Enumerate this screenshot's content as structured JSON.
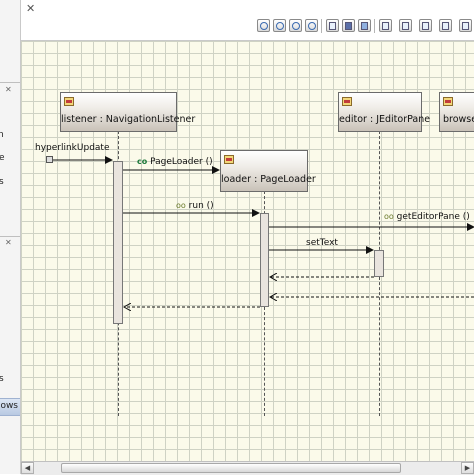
{
  "window": {
    "close_glyph": "✕"
  },
  "left_panel": {
    "fragments": [
      "n",
      "e",
      "s",
      "ows"
    ]
  },
  "toolbar": {
    "icons": [
      "zoom-in-icon",
      "zoom-out-icon",
      "zoom-fit-icon",
      "zoom-page-icon",
      "print-icon",
      "save-icon",
      "export-icon",
      "properties-icon",
      "page-setup-icon",
      "layout-icon",
      "more-icon"
    ]
  },
  "diagram": {
    "lifelines": [
      {
        "label": "listener : NavigationListener"
      },
      {
        "label": "loader : PageLoader"
      },
      {
        "label": "editor : JEditorPane"
      },
      {
        "label": "browser"
      }
    ],
    "messages": {
      "hyperlink": "hyperlinkUpdate",
      "create": "PageLoader ()",
      "create_stereo": "co",
      "run": "run ()",
      "run_stereo": "oo",
      "get_editor": "getEditorPane ()",
      "get_editor_stereo": "oo",
      "set_text": "setText"
    }
  },
  "colors": {
    "canvas": "#fbfaea",
    "grid": "#cfd2c4"
  }
}
